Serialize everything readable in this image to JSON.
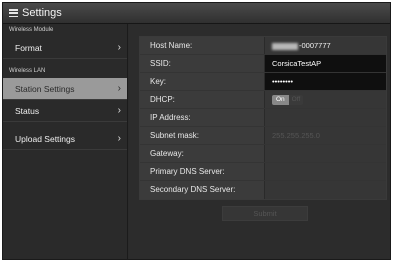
{
  "titlebar": {
    "title": "Settings",
    "menu_icon": "hamburger-menu-icon"
  },
  "sidebar": {
    "sections": [
      {
        "label": "Wireless Module",
        "items": [
          {
            "label": "Format",
            "chevron": "›"
          }
        ]
      },
      {
        "label": "Wireless LAN",
        "items": [
          {
            "label": "Station Settings",
            "chevron": "›",
            "active": true
          },
          {
            "label": "Status",
            "chevron": "›"
          }
        ]
      },
      {
        "label": "",
        "items": [
          {
            "label": "Upload Settings",
            "chevron": "›"
          }
        ]
      }
    ]
  },
  "form": {
    "host_name": {
      "label": "Host Name:",
      "value_suffix": "-0007777",
      "value_obscured": true
    },
    "ssid": {
      "label": "SSID:",
      "value": "CorsicaTestAP"
    },
    "key": {
      "label": "Key:",
      "value": "••••••••"
    },
    "dhcp": {
      "label": "DHCP:",
      "on_label": "On",
      "off_label": "Off",
      "state": "On"
    },
    "ip_address": {
      "label": "IP Address:",
      "value": ""
    },
    "subnet_mask": {
      "label": "Subnet mask:",
      "value": "255.255.255.0"
    },
    "gateway": {
      "label": "Gateway:",
      "value": ""
    },
    "primary_dns": {
      "label": "Primary DNS Server:",
      "value": ""
    },
    "secondary_dns": {
      "label": "Secondary DNS Server:",
      "value": ""
    }
  },
  "submit_label": "Submit",
  "colors": {
    "active_item_bg": "#9a9a9a",
    "active_input_bg": "#0f0f0f",
    "panel_bg": "#2b2b2b"
  }
}
